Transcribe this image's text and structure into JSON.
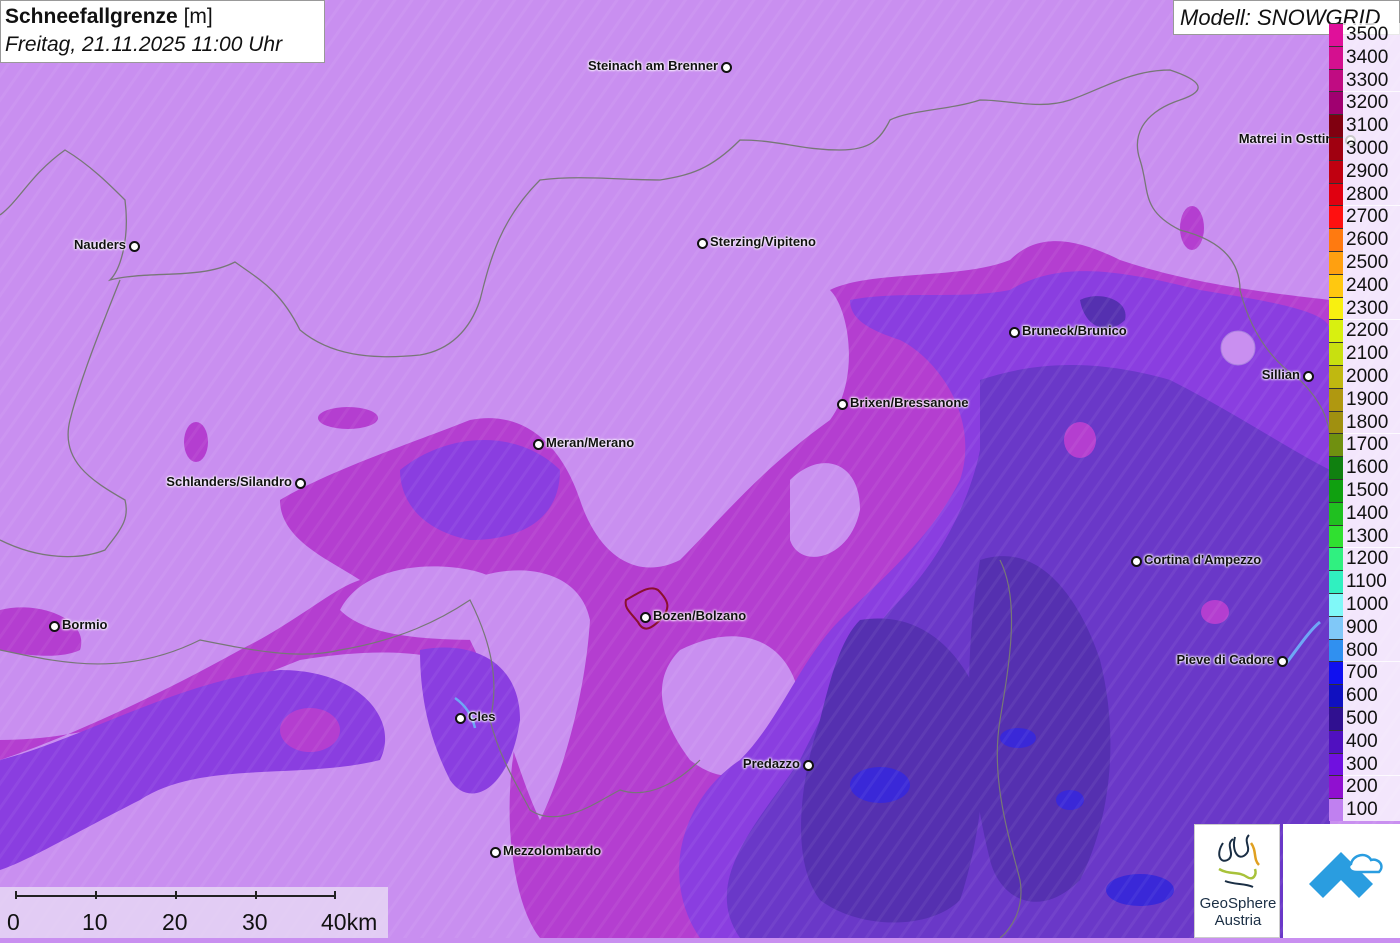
{
  "title": {
    "main": "Schneefallgrenze",
    "unit": "[m]",
    "datetime": "Freitag, 21.11.2025 11:00 Uhr"
  },
  "model": {
    "label": "Modell: SNOWGRID"
  },
  "cities": [
    {
      "name": "Steinach am Brenner",
      "label_side": "left"
    },
    {
      "name": "Nauders",
      "label_side": "left"
    },
    {
      "name": "Sterzing/Vipiteno",
      "label_side": "right"
    },
    {
      "name": "Matrei in Osttirol",
      "label_side": "left"
    },
    {
      "name": "Bruneck/Brunico",
      "label_side": "right"
    },
    {
      "name": "Sillian",
      "label_side": "left"
    },
    {
      "name": "Brixen/Bressanone",
      "label_side": "right"
    },
    {
      "name": "Meran/Merano",
      "label_side": "right"
    },
    {
      "name": "Schlanders/Silandro",
      "label_side": "left"
    },
    {
      "name": "Cortina d'Ampezzo",
      "label_side": "right"
    },
    {
      "name": "Bormio",
      "label_side": "right"
    },
    {
      "name": "Bozen/Bolzano",
      "label_side": "right"
    },
    {
      "name": "Pieve di Cadore",
      "label_side": "left"
    },
    {
      "name": "Cles",
      "label_side": "right"
    },
    {
      "name": "Predazzo",
      "label_side": "left"
    },
    {
      "name": "Mezzolombardo",
      "label_side": "right"
    }
  ],
  "legend": {
    "entries": [
      {
        "label": "3500",
        "color": "#e0109a"
      },
      {
        "label": "3400",
        "color": "#d4108f"
      },
      {
        "label": "3300",
        "color": "#c00c82"
      },
      {
        "label": "3200",
        "color": "#a00070"
      },
      {
        "label": "3100",
        "color": "#800010"
      },
      {
        "label": "3000",
        "color": "#a00010"
      },
      {
        "label": "2900",
        "color": "#c00010"
      },
      {
        "label": "2800",
        "color": "#e00010"
      },
      {
        "label": "2700",
        "color": "#ff1010"
      },
      {
        "label": "2600",
        "color": "#ff7a10"
      },
      {
        "label": "2500",
        "color": "#ffa010"
      },
      {
        "label": "2400",
        "color": "#ffc810"
      },
      {
        "label": "2300",
        "color": "#f8f010"
      },
      {
        "label": "2200",
        "color": "#d8f010"
      },
      {
        "label": "2100",
        "color": "#c8e010"
      },
      {
        "label": "2000",
        "color": "#c0b810"
      },
      {
        "label": "1900",
        "color": "#b09810"
      },
      {
        "label": "1800",
        "color": "#a09010"
      },
      {
        "label": "1700",
        "color": "#709010"
      },
      {
        "label": "1600",
        "color": "#108010"
      },
      {
        "label": "1500",
        "color": "#10a010"
      },
      {
        "label": "1400",
        "color": "#20c020"
      },
      {
        "label": "1300",
        "color": "#30e030"
      },
      {
        "label": "1200",
        "color": "#30f080"
      },
      {
        "label": "1100",
        "color": "#30f0c0"
      },
      {
        "label": "1000",
        "color": "#80f8f8"
      },
      {
        "label": "900",
        "color": "#80c8f8"
      },
      {
        "label": "800",
        "color": "#3090f0"
      },
      {
        "label": "700",
        "color": "#1010f0"
      },
      {
        "label": "600",
        "color": "#1010c0"
      },
      {
        "label": "500",
        "color": "#301090"
      },
      {
        "label": "400",
        "color": "#5010c0"
      },
      {
        "label": "300",
        "color": "#7010e0"
      },
      {
        "label": "200",
        "color": "#9010d0"
      },
      {
        "label": "100",
        "color": "#c080f0"
      }
    ]
  },
  "scalebar": {
    "labels": [
      "0",
      "10",
      "20",
      "30",
      "40km"
    ]
  },
  "logos": {
    "geosphere_name_line1": "GeoSphere",
    "geosphere_name_line2": "Austria"
  },
  "colors": {
    "light_purple": "#c98ff0",
    "mid_purple": "#b36ff0",
    "magenta": "#b43ed0",
    "violet": "#8a3ee0",
    "indigo": "#6a38c8",
    "dark": "#5530b0",
    "blue": "#3a28d8"
  }
}
